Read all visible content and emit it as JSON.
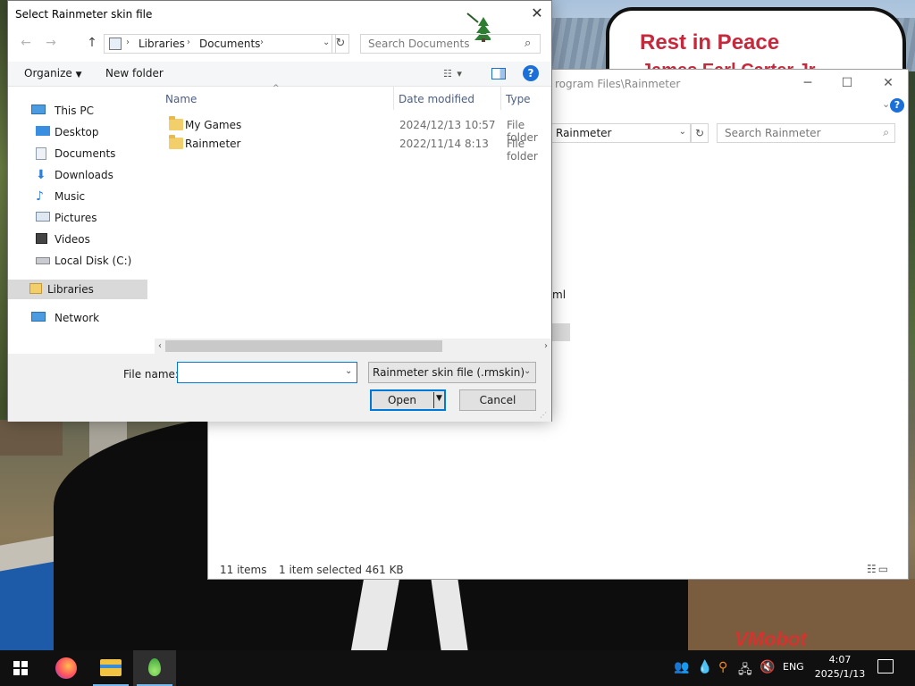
{
  "wallpaper": {
    "sign_text": "Rest in Peace",
    "sign_subtext": "James Earl Carter Jr.",
    "watermark": "VMobot"
  },
  "explorer": {
    "title_partial": "rogram Files\\Rainmeter",
    "address": "Rainmeter",
    "search_placeholder": "Search Rainmeter",
    "partial_item": "ml",
    "status_items": "11 items",
    "status_selection": "1 item selected  461 KB"
  },
  "dialog": {
    "title": "Select Rainmeter skin file",
    "breadcrumb": [
      "Libraries",
      "Documents"
    ],
    "search_placeholder": "Search Documents",
    "toolbar": {
      "organize": "Organize",
      "new_folder": "New folder"
    },
    "nav": [
      {
        "label": "This PC",
        "icon": "pc-icon"
      },
      {
        "label": "Desktop",
        "icon": "desktop-icon"
      },
      {
        "label": "Documents",
        "icon": "documents-icon"
      },
      {
        "label": "Downloads",
        "icon": "downloads-icon"
      },
      {
        "label": "Music",
        "icon": "music-icon"
      },
      {
        "label": "Pictures",
        "icon": "pictures-icon"
      },
      {
        "label": "Videos",
        "icon": "videos-icon"
      },
      {
        "label": "Local Disk (C:)",
        "icon": "disk-icon"
      },
      {
        "label": "Libraries",
        "icon": "libraries-icon"
      },
      {
        "label": "Network",
        "icon": "network-icon"
      }
    ],
    "columns": {
      "name": "Name",
      "date": "Date modified",
      "type": "Type"
    },
    "files": [
      {
        "name": "My Games",
        "date": "2024/12/13 10:57",
        "type": "File folder"
      },
      {
        "name": "Rainmeter",
        "date": "2022/11/14 8:13",
        "type": "File folder"
      }
    ],
    "file_name_label": "File name:",
    "file_name_value": "",
    "file_type": "Rainmeter skin file (.rmskin)",
    "open_label": "Open",
    "cancel_label": "Cancel"
  },
  "taskbar": {
    "apps": [
      "firefox-icon",
      "file-explorer-icon",
      "rainmeter-icon"
    ],
    "language": "ENG",
    "time": "4:07",
    "date": "2025/1/13"
  },
  "colors": {
    "accent": "#0078d7",
    "selection": "#d9d9d9",
    "taskbar": "#101010",
    "folder": "#f3cf6b"
  }
}
